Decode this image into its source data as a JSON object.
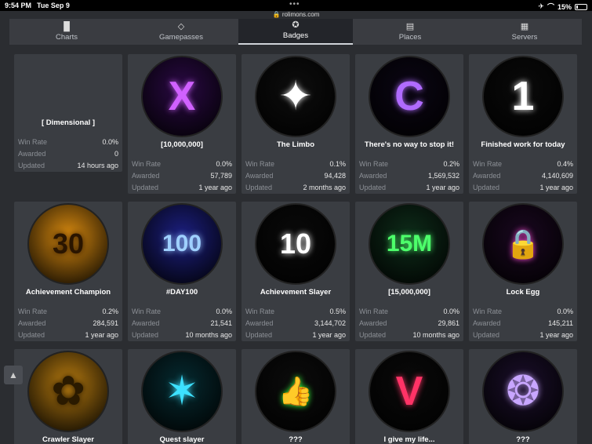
{
  "status": {
    "time": "9:54 PM",
    "date": "Tue Sep 9",
    "battery": "15%"
  },
  "browser": {
    "url": "rolimons.com"
  },
  "tabs": [
    {
      "label": "Charts",
      "icon": "bar-chart-icon"
    },
    {
      "label": "Gamepasses",
      "icon": "ticket-icon"
    },
    {
      "label": "Badges",
      "icon": "badge-icon",
      "active": true
    },
    {
      "label": "Places",
      "icon": "places-icon"
    },
    {
      "label": "Servers",
      "icon": "servers-icon"
    }
  ],
  "stat_labels": {
    "win_rate": "Win Rate",
    "awarded": "Awarded",
    "updated": "Updated"
  },
  "badges": [
    {
      "name": "[ Dimensional ]",
      "win_rate": "0.0%",
      "awarded": "0",
      "updated": "14 hours ago",
      "glyph": "",
      "bg": "#3a3d42",
      "fg": "#fff"
    },
    {
      "name": "[10,000,000]",
      "win_rate": "0.0%",
      "awarded": "57,789",
      "updated": "1 year ago",
      "glyph": "X",
      "bg": "#2a0a44",
      "fg": "#d061ff"
    },
    {
      "name": "The Limbo",
      "win_rate": "0.1%",
      "awarded": "94,428",
      "updated": "2 months ago",
      "glyph": "✦",
      "bg": "#0d0d0d",
      "fg": "#ffffff"
    },
    {
      "name": "There's no way to stop it!",
      "win_rate": "0.2%",
      "awarded": "1,569,532",
      "updated": "1 year ago",
      "glyph": "C",
      "bg": "#0b0614",
      "fg": "#b06bff"
    },
    {
      "name": "Finished work for today",
      "win_rate": "0.4%",
      "awarded": "4,140,609",
      "updated": "1 year ago",
      "glyph": "1",
      "bg": "#0a0a0a",
      "fg": "#ffffff"
    },
    {
      "name": "Achievement Champion",
      "win_rate": "0.2%",
      "awarded": "284,591",
      "updated": "1 year ago",
      "glyph": "30",
      "bg": "#d88a10",
      "fg": "#2a1500"
    },
    {
      "name": "#DAY100",
      "win_rate": "0.0%",
      "awarded": "21,541",
      "updated": "10 months ago",
      "glyph": "100",
      "bg": "#1c1f80",
      "fg": "#9fd0ff"
    },
    {
      "name": "Achievement Slayer",
      "win_rate": "0.5%",
      "awarded": "3,144,702",
      "updated": "1 year ago",
      "glyph": "10",
      "bg": "#0a0a0a",
      "fg": "#ffffff"
    },
    {
      "name": "[15,000,000]",
      "win_rate": "0.0%",
      "awarded": "29,861",
      "updated": "10 months ago",
      "glyph": "15M",
      "bg": "#0e2d1a",
      "fg": "#4dff6b"
    },
    {
      "name": "Lock Egg",
      "win_rate": "0.0%",
      "awarded": "145,211",
      "updated": "1 year ago",
      "glyph": "🔒",
      "bg": "#1a0820",
      "fg": "#ff4dd8"
    },
    {
      "name": "Crawler Slayer",
      "glyph": "✿",
      "bg": "#b57a10",
      "fg": "#2a1a00"
    },
    {
      "name": "Quest slayer",
      "glyph": "✶",
      "bg": "#062a30",
      "fg": "#3de1ff"
    },
    {
      "name": "???",
      "glyph": "👍",
      "bg": "#0c0c0c",
      "fg": "#39ff3d"
    },
    {
      "name": "I give my life...",
      "glyph": "V",
      "bg": "#0a0a0a",
      "fg": "#ff3366"
    },
    {
      "name": "???",
      "glyph": "❂",
      "bg": "#1b0f2b",
      "fg": "#c8a6ff"
    }
  ]
}
